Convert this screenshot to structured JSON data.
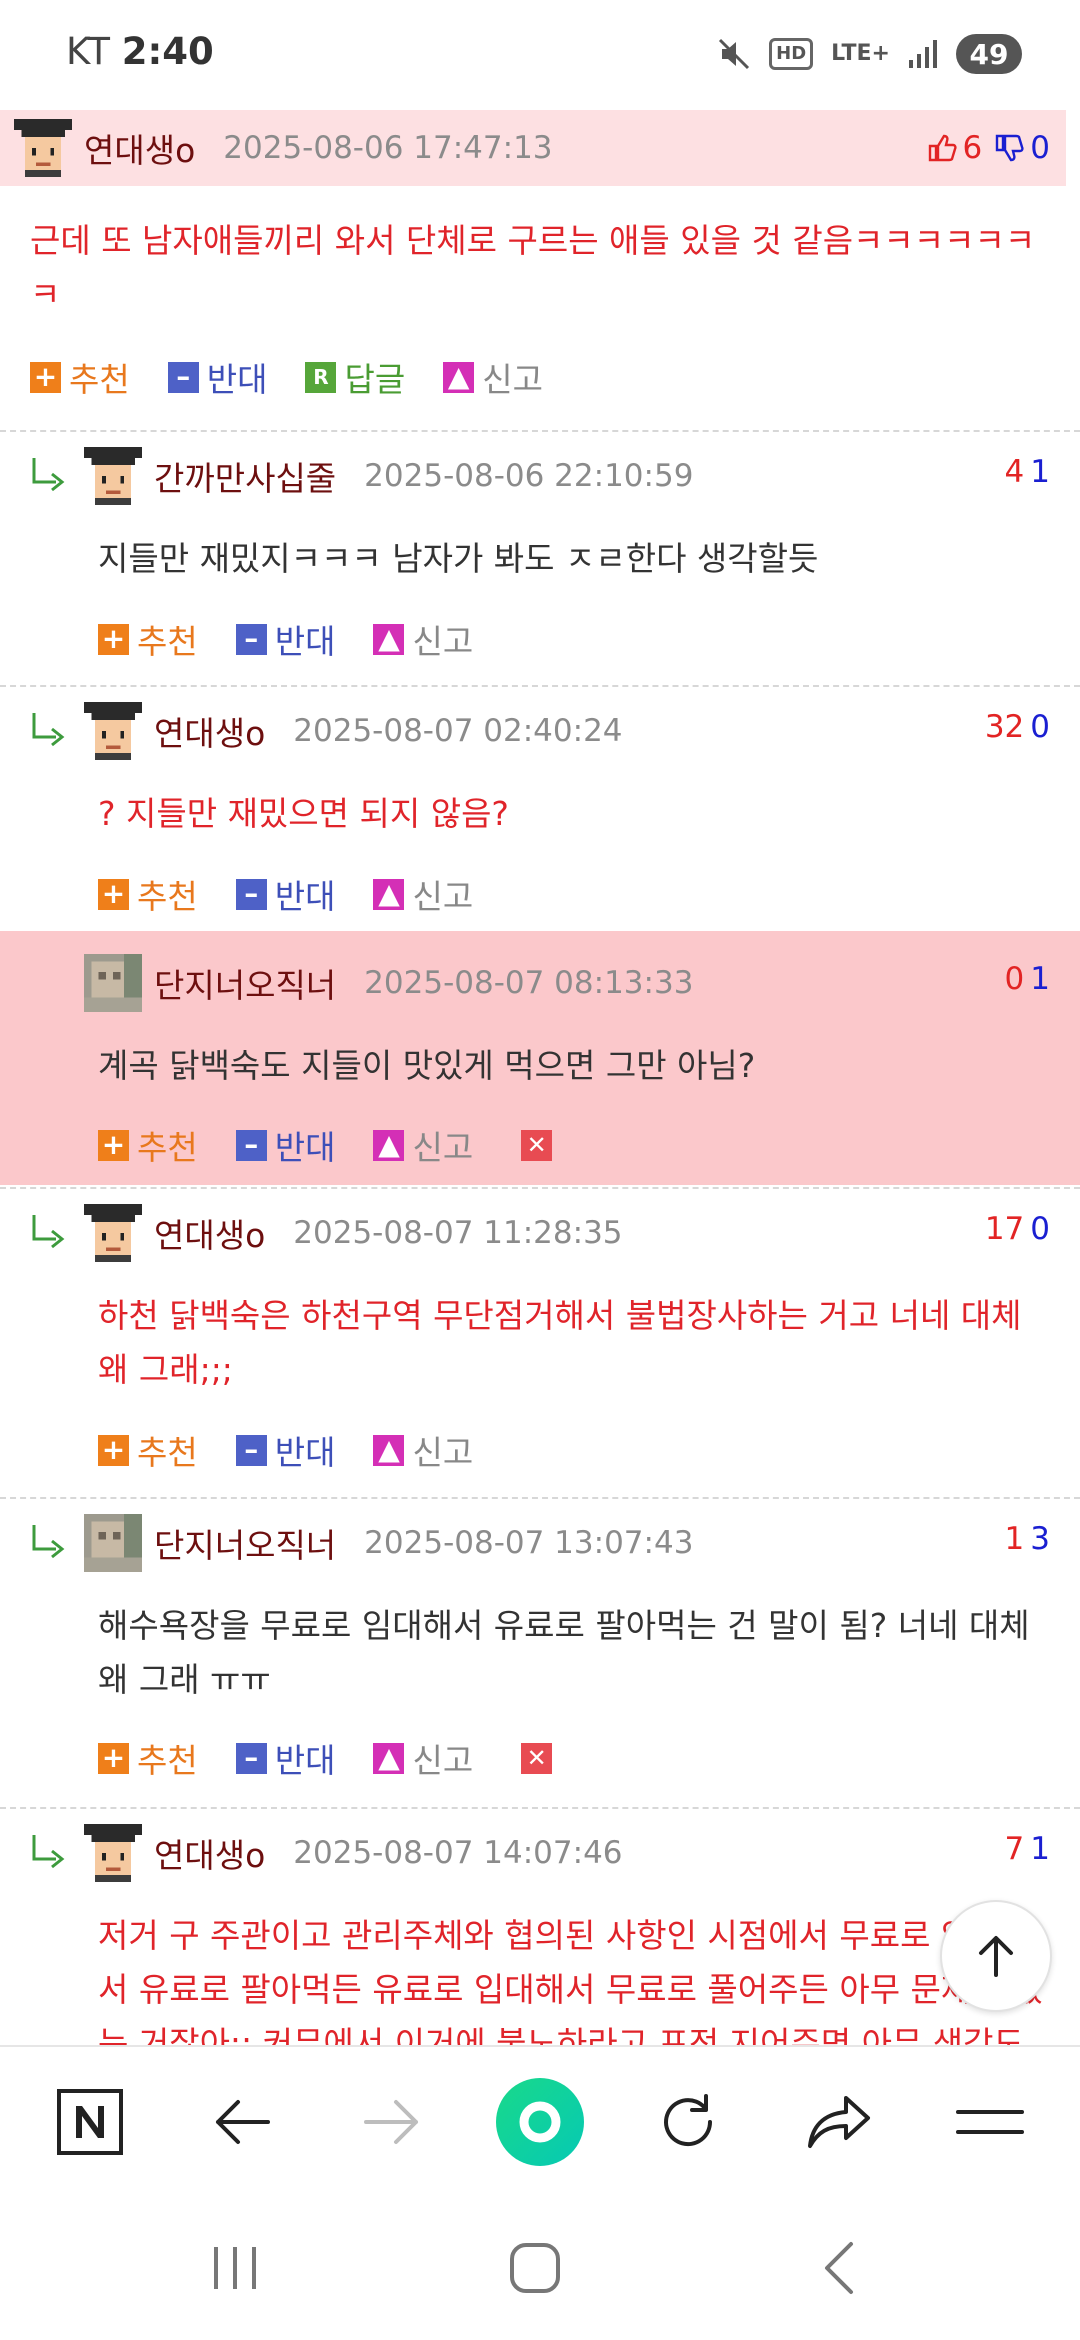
{
  "status_bar": {
    "carrier": "KT",
    "time": "2:40",
    "network": "LTE+",
    "hd_label": "HD",
    "battery": "49",
    "icons": [
      "mute-icon",
      "hd-voice-icon",
      "lte-icon",
      "signal-icon",
      "battery-icon"
    ]
  },
  "labels": {
    "recommend": "추천",
    "oppose": "반대",
    "reply": "답글",
    "report": "신고"
  },
  "comments": [
    {
      "nickname": "연대생o",
      "date": "2025-08-06 17:47:13",
      "up": "6",
      "down": "0",
      "text": "근데 또 남자애들끼리 와서 단체로 구르는 애들 있을 것 같음ㅋㅋㅋㅋㅋㅋㅋ"
    },
    {
      "nickname": "간까만사십줄",
      "date": "2025-08-06 22:10:59",
      "up": "4",
      "down": "1",
      "text": "지들만 재밌지ㅋㅋㅋ 남자가 봐도 ㅈㄹ한다 생각할듯"
    },
    {
      "nickname": "연대생o",
      "date": "2025-08-07 02:40:24",
      "up": "32",
      "down": "0",
      "text": "? 지들만 재밌으면 되지 않음?"
    },
    {
      "nickname": "단지너오직너",
      "date": "2025-08-07 08:13:33",
      "up": "0",
      "down": "1",
      "text": "계곡 닭백숙도 지들이 맛있게 먹으면 그만 아님?"
    },
    {
      "nickname": "연대생o",
      "date": "2025-08-07 11:28:35",
      "up": "17",
      "down": "0",
      "text_line1": "하천 닭백숙은 하천구역 무단점거해서 불법장사하는 거고 너네 대체",
      "text_line2": "왜 그래;;;"
    },
    {
      "nickname": "단지너오직너",
      "date": "2025-08-07 13:07:43",
      "up": "1",
      "down": "3",
      "text_line1": "해수욕장을 무료로 임대해서 유료로 팔아먹는 건 말이 됨? 너네 대체",
      "text_line2": "왜 그래 ㅠㅠ"
    },
    {
      "nickname": "연대생o",
      "date": "2025-08-07 14:07:46",
      "up": "7",
      "down": "1",
      "text_line1": "저거 구 주관이고 관리주체와 협의된 사항인 시점에서 무료로 임대해",
      "text_line2": "서 유료로 팔아먹든 유료로 입대해서 무료로 풀어주든 아무 문제가 없",
      "text_line3": "는 거잖아;; 커뮤에서 이거에 불노하라고 프전 지어주면 아무 생각도"
    }
  ],
  "toolbar": {
    "items": [
      "naver-home",
      "back",
      "forward",
      "green-dot",
      "refresh",
      "share",
      "menu"
    ]
  },
  "navbar": {
    "items": [
      "recent-apps",
      "home",
      "back"
    ]
  }
}
